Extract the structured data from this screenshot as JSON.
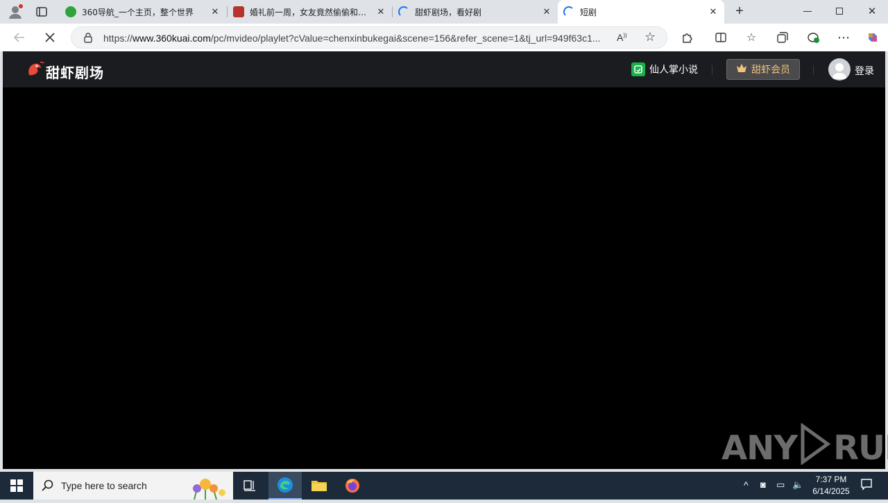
{
  "browser": {
    "tabs": [
      {
        "title": "360导航_一个主页，整个世界",
        "active": false,
        "favicon_color": "#2fa33b"
      },
      {
        "title": "婚礼前一周，女友竟然偷偷和别人",
        "active": false,
        "favicon_color": "#b5332b"
      },
      {
        "title": "甜虾剧场，看好剧",
        "active": false,
        "favicon_color": "#1a73e8"
      },
      {
        "title": "短剧",
        "active": true,
        "favicon_color": "#1a73e8"
      }
    ],
    "address": {
      "prefix": "https://",
      "host": "www.360kuai.com",
      "path": "/pc/mvideo/playlet?cValue=chenxinbukegai&scene=156&refer_scene=1&tj_url=949f63c1..."
    }
  },
  "page": {
    "logo_text": "甜虾剧场",
    "novel_link": "仙人掌小说",
    "vip_button": "甜虾会员",
    "login": "登录",
    "watermark_left": "ANY",
    "watermark_right": "RUN"
  },
  "taskbar": {
    "search_placeholder": "Type here to search",
    "time": "7:37 PM",
    "date": "6/14/2025"
  },
  "colors": {
    "header_bg": "#1b1c20",
    "vip_text": "#f0c27a",
    "novel_green": "#16b24a"
  }
}
